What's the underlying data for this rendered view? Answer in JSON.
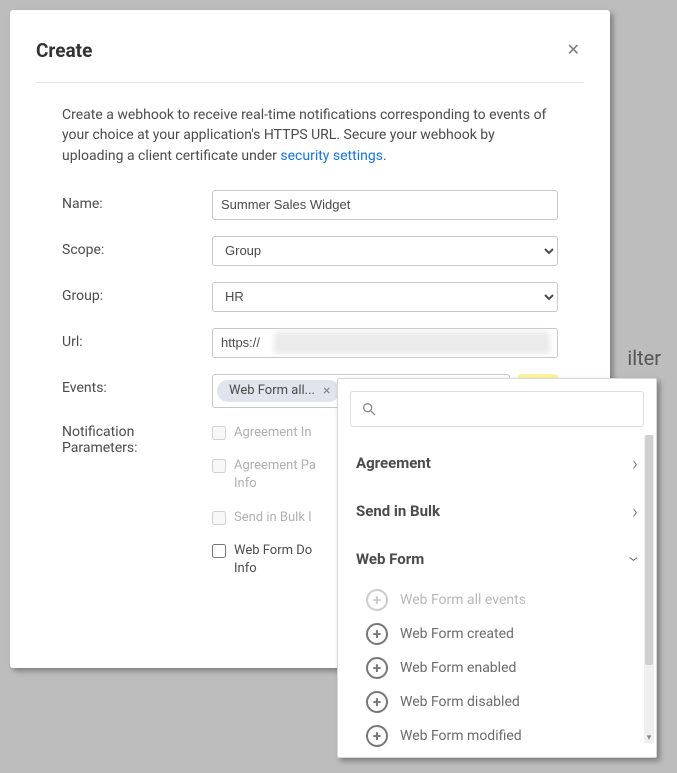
{
  "backdrop": {
    "filter_text": "ilter"
  },
  "modal": {
    "title": "Create",
    "description_pre": "Create a webhook to receive real-time notifications corresponding to events of your choice at your application's HTTPS URL. Secure your webhook by uploading a client certificate under ",
    "description_link": "security settings",
    "description_post": ".",
    "labels": {
      "name": "Name:",
      "scope": "Scope:",
      "group": "Group:",
      "url": "Url:",
      "events": "Events:",
      "notification_params": "Notification Parameters:"
    },
    "fields": {
      "name_value": "Summer Sales Widget",
      "scope_value": "Group",
      "group_value": "HR",
      "url_value": "https://",
      "event_chip": "Web Form all..."
    },
    "checkboxes": [
      {
        "label_a": "Agreement In",
        "label_b": "",
        "enabled": false
      },
      {
        "label_a": "Agreement Pa",
        "label_b": "Info",
        "enabled": false
      },
      {
        "label_a": "Send in Bulk I",
        "label_b": "",
        "enabled": false
      },
      {
        "label_a": "Web Form Do",
        "label_b": "Info",
        "enabled": true
      }
    ]
  },
  "dropdown": {
    "search_placeholder": "",
    "categories": [
      {
        "name": "Agreement",
        "expanded": false
      },
      {
        "name": "Send in Bulk",
        "expanded": false
      },
      {
        "name": "Web Form",
        "expanded": true
      }
    ],
    "webform_items": [
      {
        "label": "Web Form all events",
        "disabled": true
      },
      {
        "label": "Web Form created",
        "disabled": false
      },
      {
        "label": "Web Form enabled",
        "disabled": false
      },
      {
        "label": "Web Form disabled",
        "disabled": false
      },
      {
        "label": "Web Form modified",
        "disabled": false
      }
    ]
  }
}
